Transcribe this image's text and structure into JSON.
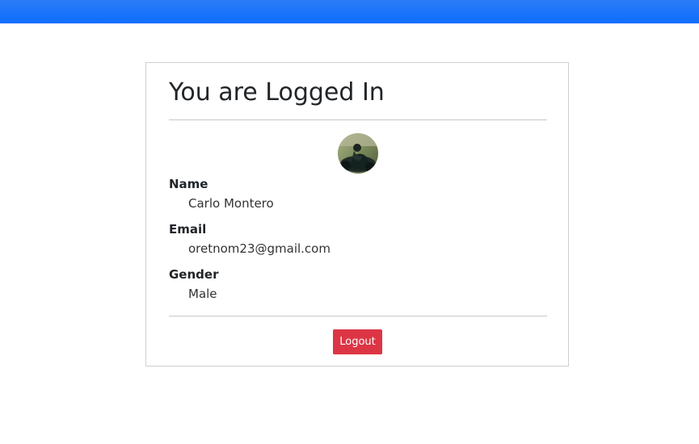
{
  "header": {
    "bar_color": "#1a73f8"
  },
  "card": {
    "title": "You are Logged In",
    "avatar": {
      "icon": "user-avatar-photo"
    },
    "fields": [
      {
        "label": "Name",
        "value": "Carlo Montero"
      },
      {
        "label": "Email",
        "value": "oretnom23@gmail.com"
      },
      {
        "label": "Gender",
        "value": "Male"
      }
    ],
    "logout_label": "Logout",
    "logout_color": "#dc3545"
  }
}
